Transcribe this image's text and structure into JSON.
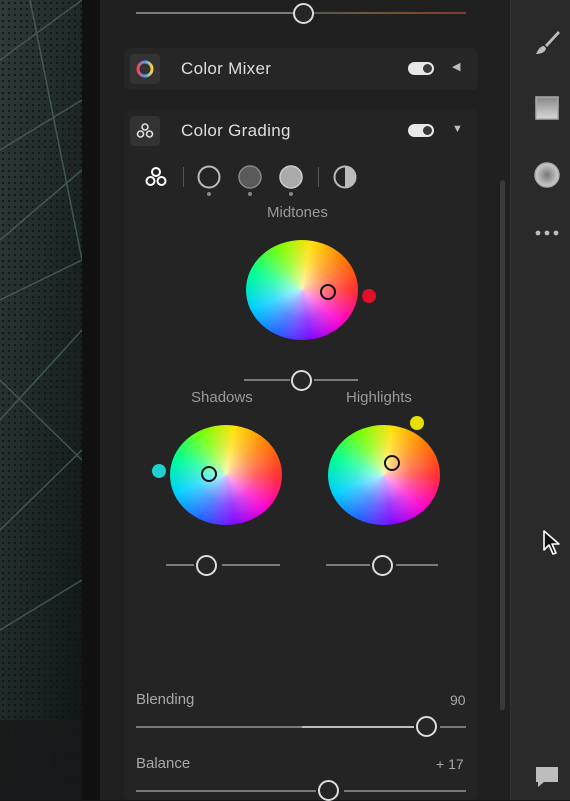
{
  "sections": {
    "color_mixer": {
      "title": "Color Mixer",
      "enabled": true,
      "collapsed": true
    },
    "color_grading": {
      "title": "Color Grading",
      "enabled": true,
      "collapsed": false
    }
  },
  "wheels": {
    "midtones": {
      "label": "Midtones",
      "tint_color": "#e0102a"
    },
    "shadows": {
      "label": "Shadows",
      "tint_color": "#1fd0cf"
    },
    "highlights": {
      "label": "Highlights",
      "tint_color": "#e8e000"
    }
  },
  "adjustments": {
    "blending": {
      "label": "Blending",
      "value": "90"
    },
    "balance": {
      "label": "Balance",
      "value": "+ 17"
    }
  },
  "colors": {
    "panel": "#202020",
    "accent_knob": "#dddddd"
  },
  "icons": [
    "brush-icon",
    "gradient-icon",
    "radial-icon",
    "more-icon",
    "comment-icon",
    "three-circles-icon",
    "color-wheel-icon",
    "half-circle-icon",
    "cursor-icon"
  ]
}
